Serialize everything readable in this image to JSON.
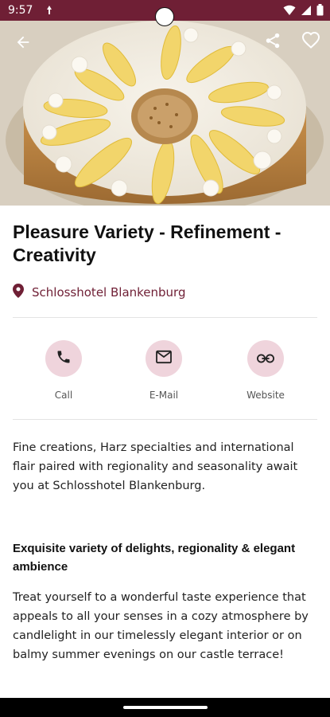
{
  "status_bar": {
    "time": "9:57",
    "extra_icon": "data-saver-icon",
    "wifi_icon": "wifi-icon",
    "signal_icon": "signal-icon",
    "battery_icon": "battery-icon"
  },
  "hero": {
    "back_icon": "back-arrow-icon",
    "share_icon": "share-icon",
    "favorite_icon": "heart-icon"
  },
  "title": "Pleasure Variety - Refinement - Creativity",
  "location": {
    "icon": "location-pin-icon",
    "name": "Schlosshotel Blankenburg"
  },
  "actions": [
    {
      "label": "Call",
      "icon": "phone-icon"
    },
    {
      "label": "E-Mail",
      "icon": "mail-icon"
    },
    {
      "label": "Website",
      "icon": "link-icon"
    }
  ],
  "description": "Fine creations, Harz specialties and international flair paired with regionality and seasonality await you at Schlosshotel Blankenburg.",
  "section": {
    "heading": "Exquisite variety of delights, regionality & elegant ambience",
    "body": "Treat yourself to a wonderful taste experience that appeals to all your senses in a cozy atmosphere by candlelight in our timelessly elegant interior or on balmy summer evenings on our castle terrace!"
  },
  "colors": {
    "brand": "#6f1f35",
    "action_circle": "#efd4dc"
  }
}
